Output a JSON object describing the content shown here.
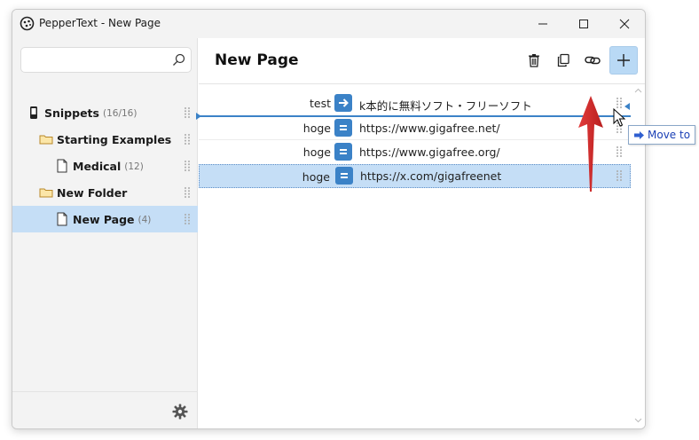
{
  "window": {
    "title": "PepperText - New Page"
  },
  "sidebar": {
    "search": {
      "value": "",
      "placeholder": ""
    },
    "items": [
      {
        "label": "Snippets",
        "count": "(16/16)",
        "type": "root"
      },
      {
        "label": "Starting Examples",
        "count": "",
        "type": "folder"
      },
      {
        "label": "Medical",
        "count": "(12)",
        "type": "page"
      },
      {
        "label": "New Folder",
        "count": "",
        "type": "folder"
      },
      {
        "label": "New Page",
        "count": "(4)",
        "type": "page",
        "selected": true
      }
    ]
  },
  "main": {
    "page_title": "New Page",
    "toolbar": [
      "trash-icon",
      "copy-icon",
      "link-icon",
      "plus-icon"
    ],
    "rows": [
      {
        "key": "test",
        "op": "arrow",
        "value": "k本的に無料ソフト・フリーソフト"
      },
      {
        "key": "hoge",
        "op": "equals",
        "value": "https://www.gigafree.net/"
      },
      {
        "key": "hoge",
        "op": "equals",
        "value": "https://www.gigafree.org/"
      },
      {
        "key": "hoge",
        "op": "equals",
        "value": "https://x.com/gigafreenet",
        "selected": true
      }
    ]
  },
  "drag_tooltip": {
    "label": "Move to"
  },
  "colors": {
    "accent": "#3b82c7",
    "selection": "#c5def6",
    "annotation_arrow": "#d42b2b"
  }
}
